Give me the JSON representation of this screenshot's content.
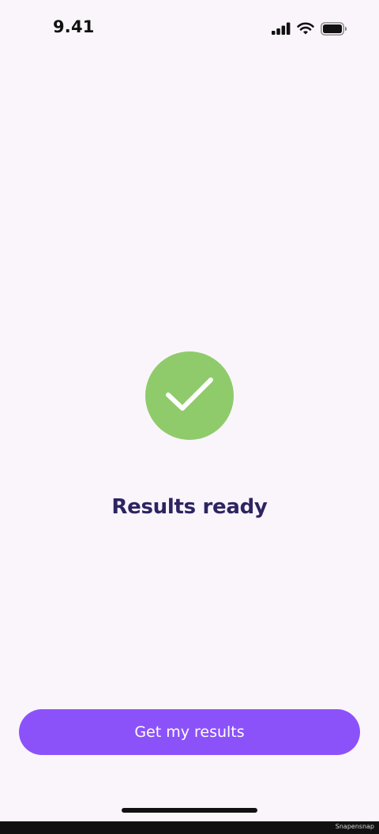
{
  "status_bar": {
    "time": "9.41",
    "icons": [
      "cellular-signal-icon",
      "wifi-icon",
      "battery-icon"
    ]
  },
  "main": {
    "icon": "checkmark-icon",
    "title": "Results ready"
  },
  "footer": {
    "button_label": "Get my results"
  },
  "watermark": {
    "text": "Snapensnap"
  },
  "colors": {
    "background": "#faf5fb",
    "success_green": "#8fcb6b",
    "title_text": "#2d2461",
    "primary_button": "#8c52fa"
  }
}
